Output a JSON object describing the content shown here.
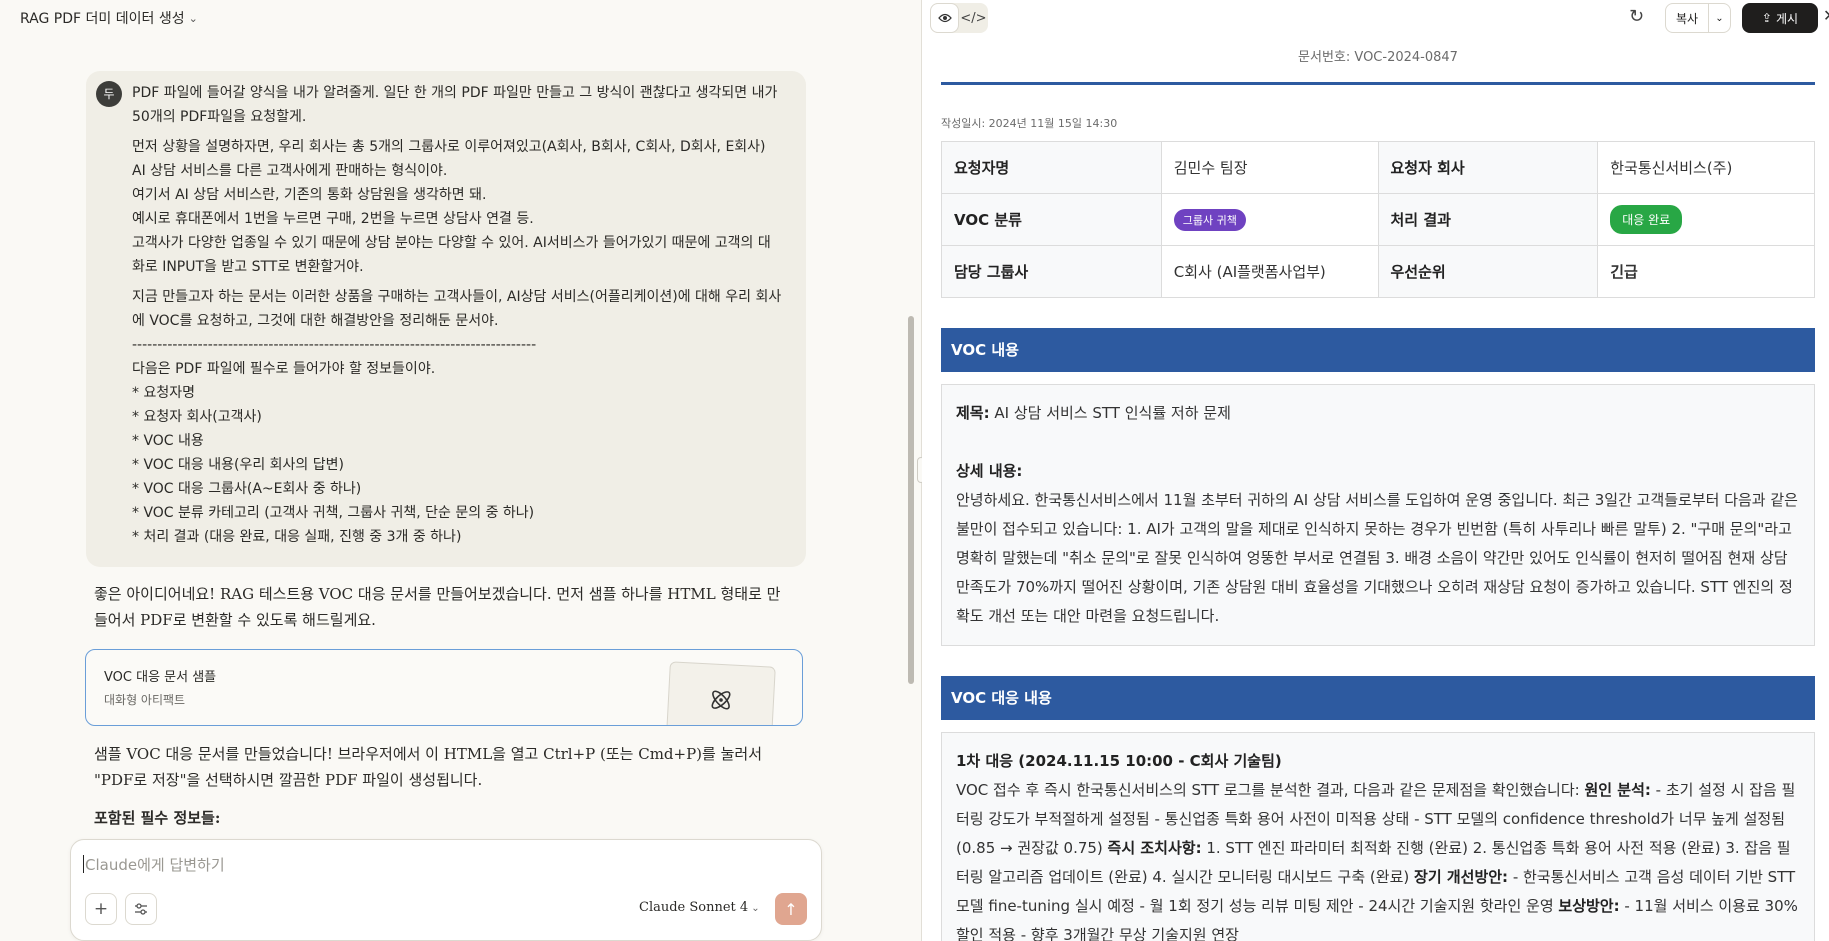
{
  "left": {
    "chat_title": "RAG PDF 더미 데이터 생성",
    "user_avatar": "두",
    "user_message": {
      "p1": "PDF 파일에 들어갈 양식을 내가 알려줄게. 일단 한 개의 PDF 파일만 만들고 그 방식이 괜찮다고 생각되면 내가 50개의 PDF파일을 요청할게.",
      "p2": "먼저 상황을 설명하자면, 우리 회사는 총 5개의 그룹사로 이루어져있고(A회사, B회사, C회사, D회사, E회사) AI 상담 서비스를 다른 고객사에게 판매하는 형식이야.\n여기서 AI 상담 서비스란, 기존의 통화 상담원을 생각하면 돼.\n예시로 휴대폰에서 1번을 누르면 구매, 2번을 누르면 상담사 연결 등.\n고객사가 다양한 업종일 수 있기 때문에 상담 분야는 다양할 수 있어. AI서비스가 들어가있기 때문에 고객의 대화로 INPUT을 받고 STT로 변환할거야.",
      "p3": "지금 만들고자 하는 문서는 이러한 상품을 구매하는 고객사들이, AI상담 서비스(어플리케이션)에 대해 우리 회사에 VOC를 요청하고, 그것에 대한 해결방안을 정리해둔 문서야.\n--------------------------------------------------------------------------------\n다음은 PDF 파일에 필수로 들어가야 할 정보들이야.\n* 요청자명\n* 요청자 회사(고객사)\n* VOC 내용\n* VOC 대응 내용(우리 회사의 답변)\n* VOC 대응 그룹사(A~E회사 중 하나)\n* VOC 분류 카테고리 (고객사 귀책, 그룹사 귀책, 단순 문의 중 하나)\n* 처리 결과 (대응 완료, 대응 실패, 진행 중 3개 중 하나)"
    },
    "assistant_1": "좋은 아이디어네요! RAG 테스트용 VOC 대응 문서를 만들어보겠습니다. 먼저 샘플 하나를 HTML 형태로 만들어서 PDF로 변환할 수 있도록 해드릴게요.",
    "artifact": {
      "title": "VOC 대응 문서 샘플",
      "subtitle": "대화형 아티팩트"
    },
    "assistant_2": "샘플 VOC 대응 문서를 만들었습니다! 브라우저에서 이 HTML을 열고 Ctrl+P (또는 Cmd+P)를 눌러서 \"PDF로 저장\"을 선택하시면 깔끔한 PDF 파일이 생성됩니다.",
    "assistant_3": "포함된 필수 정보들:",
    "composer": {
      "placeholder": "Claude에게 답변하기",
      "model": "Claude Sonnet 4"
    }
  },
  "right": {
    "toolbar": {
      "copy": "복사",
      "publish": "게시"
    },
    "doc_number": "문서번호: VOC-2024-0847",
    "written_at": "작성일시: 2024년 11월 15일 14:30",
    "info": {
      "requester_label": "요청자명",
      "requester": "김민수 팀장",
      "company_label": "요청자 회사",
      "company": "한국통신서비스(주)",
      "category_label": "VOC 분류",
      "category": "그룹사 귀책",
      "result_label": "처리 결과",
      "result": "대응 완료",
      "group_label": "담당 그룹사",
      "group": "C회사 (AI플랫폼사업부)",
      "priority_label": "우선순위",
      "priority": "긴급"
    },
    "voc": {
      "header": "VOC 내용",
      "title_label": "제목:",
      "title": "AI 상담 서비스 STT 인식률 저하 문제",
      "detail_label": "상세 내용:",
      "detail": "안녕하세요. 한국통신서비스에서 11월 초부터 귀하의 AI 상담 서비스를 도입하여 운영 중입니다. 최근 3일간 고객들로부터 다음과 같은 불만이 접수되고 있습니다: 1. AI가 고객의 말을 제대로 인식하지 못하는 경우가 빈번함 (특히 사투리나 빠른 말투) 2. \"구매 문의\"라고 명확히 말했는데 \"취소 문의\"로 잘못 인식하여 엉뚱한 부서로 연결됨 3. 배경 소음이 약간만 있어도 인식률이 현저히 떨어짐 현재 상담 만족도가 70%까지 떨어진 상황이며, 기존 상담원 대비 효율성을 기대했으나 오히려 재상담 요청이 증가하고 있습니다. STT 엔진의 정확도 개선 또는 대안 마련을 요청드립니다."
    },
    "response": {
      "header": "VOC 대응 내용",
      "first_label": "1차 대응 (2024.11.15 10:00 - C회사 기술팀)",
      "t1": "VOC 접수 후 즉시 한국통신서비스의 STT 로그를 분석한 결과, 다음과 같은 문제점을 확인했습니다: ",
      "b1": "원인 분석:",
      "t2": " - 초기 설정 시 잡음 필터링 강도가 부적절하게 설정됨 - 통신업종 특화 용어 사전이 미적용 상태 - STT 모델의 confidence threshold가 너무 높게 설정됨 (0.85 → 권장값 0.75) ",
      "b2": "즉시 조치사항:",
      "t3": " 1. STT 엔진 파라미터 최적화 진행 (완료) 2. 통신업종 특화 용어 사전 적용 (완료) 3. 잡음 필터링 알고리즘 업데이트 (완료) 4. 실시간 모니터링 대시보드 구축 (완료) ",
      "b3": "장기 개선방안:",
      "t4": " - 한국통신서비스 고객 음성 데이터 기반 STT 모델 fine-tuning 실시 예정 - 월 1회 정기 성능 리뷰 미팅 제안 - 24시간 기술지원 핫라인 운영 ",
      "b4": "보상방안:",
      "t5": " - 11월 서비스 이용료 30% 할인 적용 - 향후 3개월간 무상 기술지원 연장"
    }
  },
  "colors": {
    "section_blue": "#2d5aa0",
    "badge_purple": "#6f42c1",
    "badge_green": "#28a745",
    "urgent_red": "#d0312d",
    "send_orange": "#e0a690"
  }
}
